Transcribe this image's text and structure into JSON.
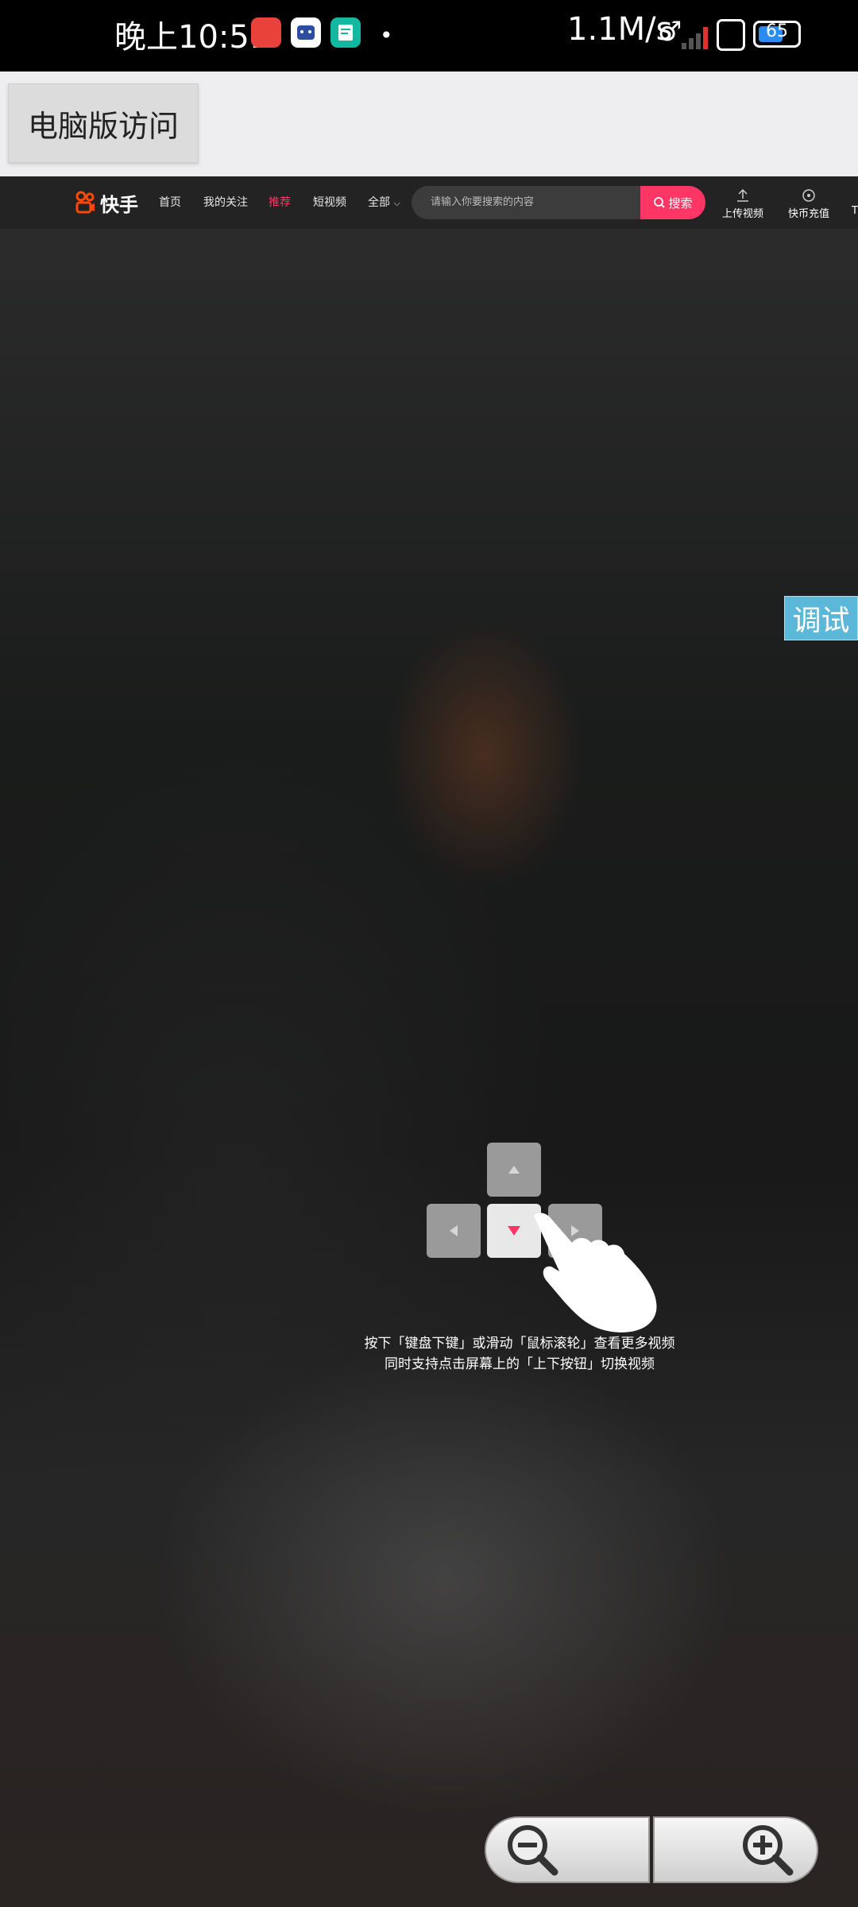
{
  "status_bar": {
    "time": "晚上10:51",
    "network_speed": "1.1M/s",
    "battery": "65",
    "notification_icons": [
      "app-heart-icon",
      "app-cat-icon",
      "app-note-icon"
    ]
  },
  "pc_bar": {
    "button_label": "电脑版访问"
  },
  "nav": {
    "logo_text": "快手",
    "items": [
      "首页",
      "我的关注",
      "推荐",
      "短视频",
      "全部"
    ],
    "active_item": "推荐",
    "search_placeholder": "请输入你要搜索的内容",
    "search_button": "搜索",
    "actions": [
      "上传视频",
      "快币充值",
      "T"
    ]
  },
  "debug_button": "调试",
  "hint": {
    "line1": "按下「键盘下键」或滑动「鼠标滚轮」查看更多视频",
    "line2": "同时支持点击屏幕上的「上下按钮」切换视频"
  },
  "colors": {
    "accent": "#fe3666",
    "debug": "#5bb8d8",
    "nav_bg": "#232323"
  }
}
